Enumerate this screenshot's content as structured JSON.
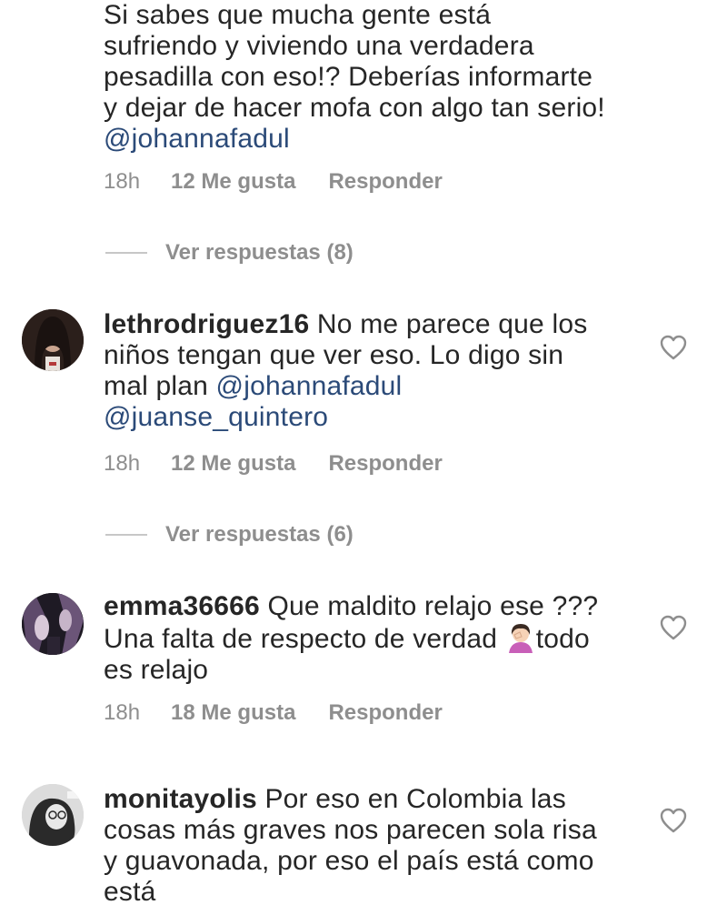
{
  "comments": [
    {
      "username": "",
      "text_lines": [
        "Si sabes que mucha gente está",
        "sufriendo y viviendo una verdadera",
        "pesadilla con eso!? Deberías informarte",
        "y dejar de hacer mofa con algo tan serio!"
      ],
      "mentions": [
        "@johannafadul"
      ],
      "time": "18h",
      "likes": "12 Me gusta",
      "reply": "Responder",
      "view_replies": "Ver respuestas (8)"
    },
    {
      "username": "lethrodriguez16",
      "text_first": "No me parece que los",
      "text_lines": [
        "niños tengan que ver eso. Lo digo sin"
      ],
      "text_mal_plan": "mal plan",
      "mentions": [
        "@johannafadul",
        "@juanse_quintero"
      ],
      "time": "18h",
      "likes": "12 Me gusta",
      "reply": "Responder",
      "view_replies": "Ver respuestas (6)",
      "heart_icon": "heart-outline-icon"
    },
    {
      "username": "emma36666",
      "text_first": "Que maldito relajo ese ???",
      "text_line2_a": "Una falta de respecto de verdad",
      "emoji": "facepalm-woman-emoji",
      "text_line2_b": "todo",
      "text_line3": "es relajo",
      "time": "18h",
      "likes": "18 Me gusta",
      "reply": "Responder",
      "heart_icon": "heart-outline-icon"
    },
    {
      "username": "monitayolis",
      "text_first": "Por eso en Colombia las",
      "text_lines": [
        "cosas más graves nos parecen sola risa",
        "y guavonada, por eso el país está como",
        "está"
      ],
      "heart_icon": "heart-outline-icon"
    }
  ],
  "colors": {
    "text": "#262626",
    "meta": "#8e8e8e",
    "mention": "#2b4a78",
    "divider": "#c7c7c7"
  }
}
